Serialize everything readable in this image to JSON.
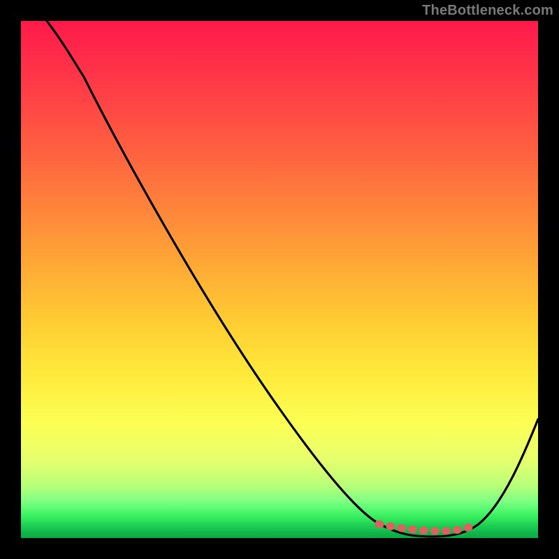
{
  "watermark": "TheBottleneck.com",
  "chart_data": {
    "type": "line",
    "title": "",
    "xlabel": "",
    "ylabel": "",
    "xlim": [
      0,
      100
    ],
    "ylim": [
      0,
      100
    ],
    "grid": false,
    "legend": false,
    "background_gradient": {
      "top": "#ff1a4b",
      "mid": "#ffe93a",
      "bottom": "#0aa944"
    },
    "series": [
      {
        "name": "bottleneck-curve",
        "color": "#000000",
        "x": [
          5,
          10,
          15,
          20,
          25,
          30,
          35,
          40,
          45,
          50,
          55,
          60,
          65,
          70,
          75,
          80,
          85,
          90,
          95,
          100
        ],
        "y": [
          100,
          95,
          88,
          80,
          72,
          64,
          56,
          48,
          40,
          32,
          24,
          16,
          9,
          4,
          1,
          0,
          0,
          3,
          10,
          22
        ]
      },
      {
        "name": "optimal-range-marker",
        "color": "#d9635e",
        "x": [
          70,
          72,
          74,
          76,
          78,
          80,
          82,
          84,
          86
        ],
        "y": [
          3,
          2.5,
          2.2,
          2.1,
          2.1,
          2.1,
          2.3,
          2.6,
          3
        ]
      }
    ],
    "optimal_range_x": [
      70,
      86
    ],
    "annotations": []
  }
}
